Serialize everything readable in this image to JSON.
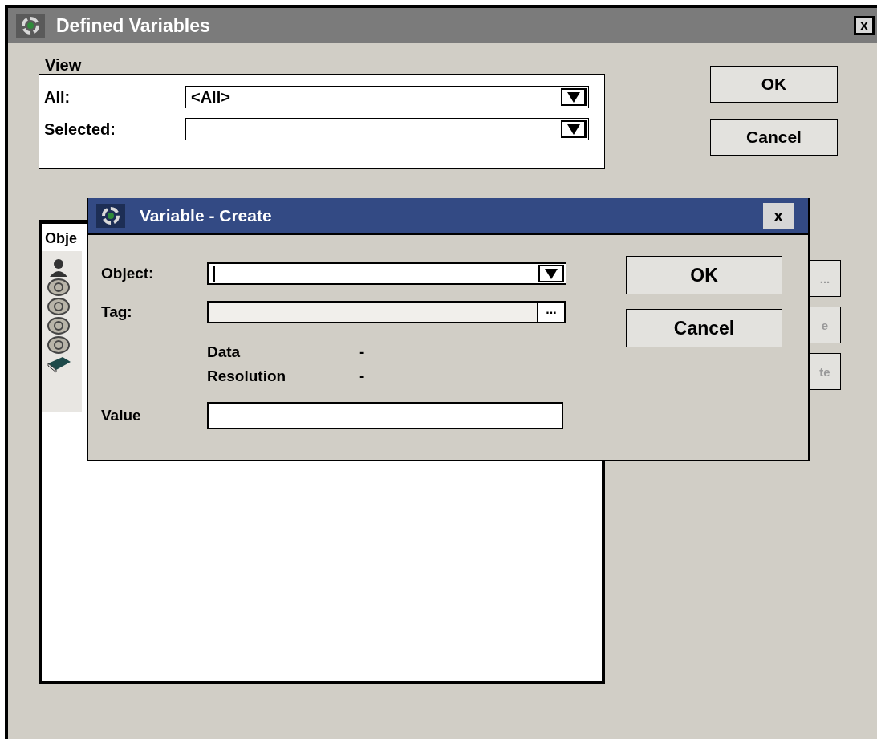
{
  "window": {
    "title": "Defined Variables",
    "close": "x"
  },
  "view": {
    "label": "View",
    "fields": [
      {
        "label": "All:",
        "value": "<All>"
      },
      {
        "label": "Selected:"
      }
    ]
  },
  "buttons": [
    {
      "label": "OK",
      "disabled": false
    },
    {
      "label": "Cancel",
      "disabled": false
    },
    {
      "label": "...",
      "disabled": true
    },
    {
      "label": "e",
      "disabled": true
    },
    {
      "label": "te",
      "disabled": true
    }
  ],
  "list": {
    "column": "Obje",
    "rows": [
      {
        "kind": "person"
      },
      {
        "kind": "eye"
      },
      {
        "kind": "eye"
      },
      {
        "kind": "eye"
      },
      {
        "kind": "eye"
      },
      {
        "kind": "book"
      }
    ]
  },
  "dialog": {
    "title": "Variable - Create",
    "close": "x",
    "fields": [
      {
        "kind": "dropdown",
        "label": "Object:",
        "focused": true,
        "disabled": false
      },
      {
        "kind": "browse",
        "label": "Tag:",
        "button": "...",
        "focused": false,
        "disabled": true
      }
    ],
    "info": [
      {
        "label": "Data",
        "value": "-"
      },
      {
        "label": "Resolution",
        "value": "-"
      }
    ],
    "value": {
      "label": "Value"
    },
    "buttons": [
      "OK",
      "Cancel"
    ]
  }
}
